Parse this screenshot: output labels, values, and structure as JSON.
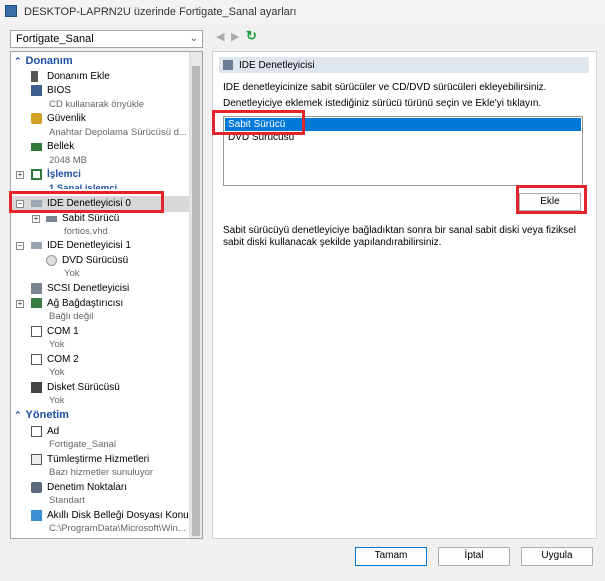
{
  "window": {
    "title": "DESKTOP-LAPRN2U üzerinde Fortigate_Sanal ayarları"
  },
  "vm_selector": {
    "value": "Fortigate_Sanal"
  },
  "tree": {
    "hardware_header": "Donanım",
    "add_hardware": "Donanım Ekle",
    "bios": {
      "label": "BIOS",
      "sub": "CD kullanarak önyükle"
    },
    "security": {
      "label": "Güvenlik",
      "sub": "Anahtar Depolama Sürücüsü d..."
    },
    "memory": {
      "label": "Bellek",
      "sub": "2048 MB"
    },
    "processor": {
      "label": "İşlemci",
      "sub": "1 Sanal işlemci"
    },
    "ide0": {
      "label": "IDE Denetleyicisi 0"
    },
    "hard_drive": {
      "label": "Sabit Sürücü",
      "sub": "fortios.vhd"
    },
    "ide1": {
      "label": "IDE Denetleyicisi 1"
    },
    "dvd": {
      "label": "DVD Sürücüsü",
      "sub": "Yok"
    },
    "scsi": {
      "label": "SCSI Denetleyicisi"
    },
    "network": {
      "label": "Ağ Bağdaştırıcısı",
      "sub": "Bağlı değil"
    },
    "com1": {
      "label": "COM 1",
      "sub": "Yok"
    },
    "com2": {
      "label": "COM 2",
      "sub": "Yok"
    },
    "diskette": {
      "label": "Disket Sürücüsü",
      "sub": "Yok"
    },
    "management_header": "Yönetim",
    "name": {
      "label": "Ad",
      "sub": "Fortigate_Sanal"
    },
    "integration": {
      "label": "Tümleştirme Hizmetleri",
      "sub": "Bazı hizmetler sunuluyor"
    },
    "checkpoints": {
      "label": "Denetim Noktaları",
      "sub": "Standart"
    },
    "paging": {
      "label": "Akıllı Disk Belleği Dosyası Konumu",
      "sub": "C:\\ProgramData\\Microsoft\\Win..."
    }
  },
  "panel": {
    "title": "IDE Denetleyicisi",
    "intro": "IDE denetleyicinize sabit sürücüler ve CD/DVD sürücüleri ekleyebilirsiniz.",
    "instruction": "Denetleyiciye eklemek istediğiniz sürücü türünü seçin ve Ekle'yi tıklayın.",
    "drive_types": [
      "Sabit Sürücü",
      "DVD Sürücüsü"
    ],
    "selected_drive_type": "Sabit Sürücü",
    "add_button": "Ekle",
    "note": "Sabit sürücüyü denetleyiciye bağladıktan sonra bir sanal sabit diski veya fiziksel sabit diski kullanacak şekilde yapılandırabilirsiniz."
  },
  "footer": {
    "ok": "Tamam",
    "cancel": "İptal",
    "apply": "Uygula"
  },
  "colors": {
    "highlight_box": "#e3242b",
    "selection": "#0078d7",
    "section_header": "#1c50a0"
  }
}
